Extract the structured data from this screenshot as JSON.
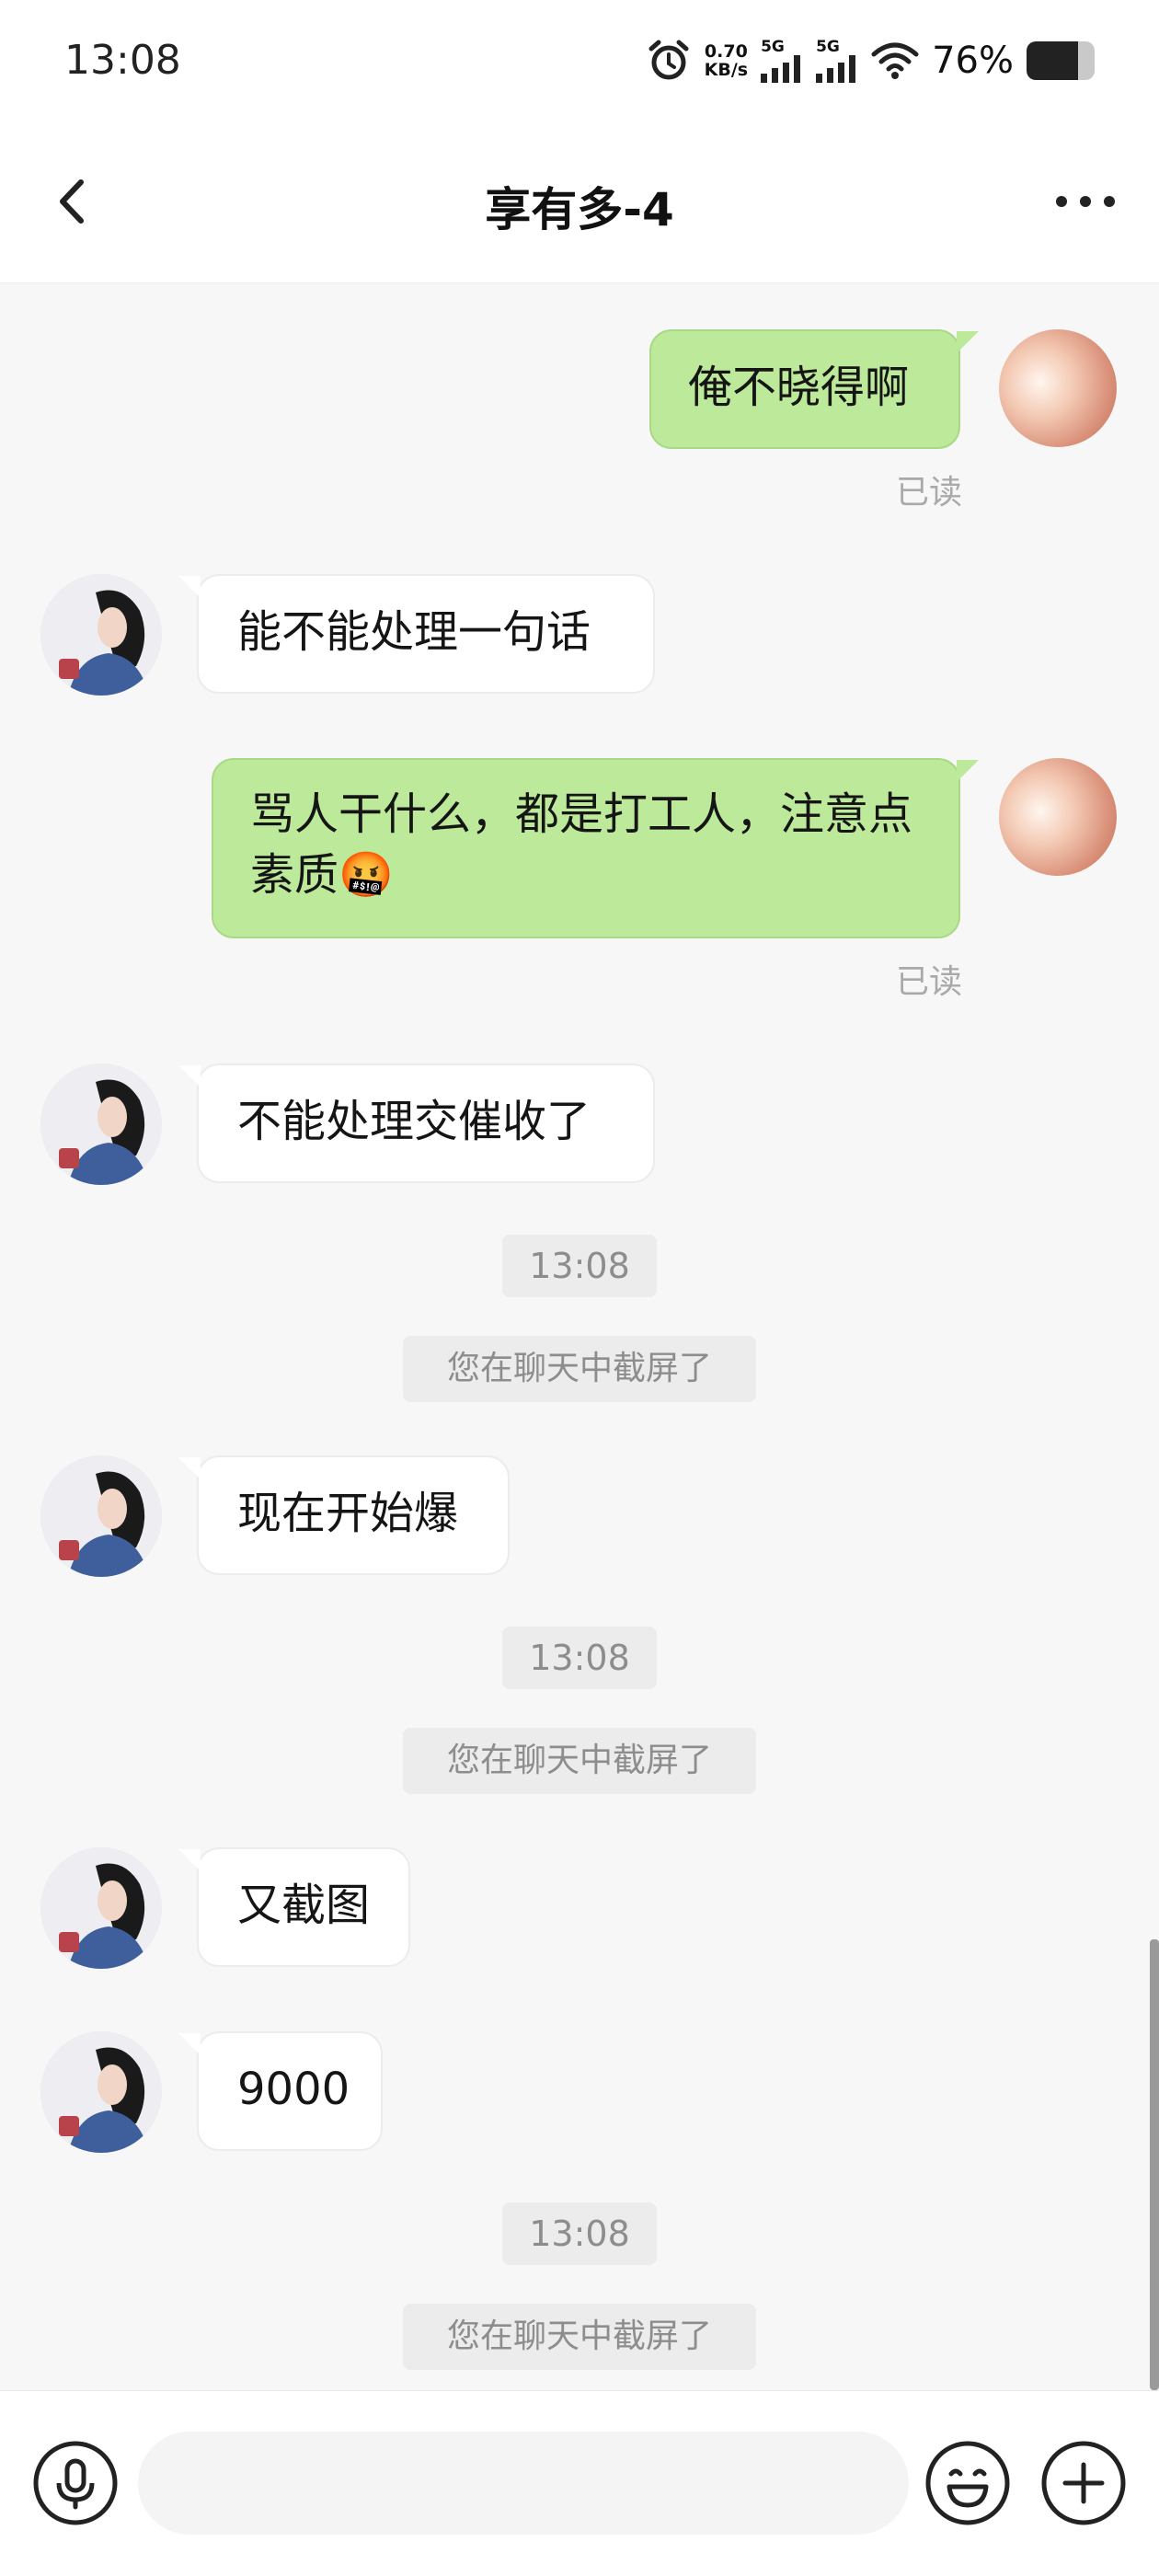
{
  "status_bar": {
    "time": "13:08",
    "net_speed_value": "0.70",
    "net_speed_unit": "KB/s",
    "sim1_label": "5G",
    "sim2_label": "5G",
    "battery_percent": "76%",
    "battery_level": 0.76,
    "icons": [
      "alarm-icon",
      "signal-icon",
      "signal-icon",
      "wifi-icon",
      "battery-icon"
    ]
  },
  "header": {
    "title": "享有多-4",
    "back_icon": "chevron-left-icon",
    "more_icon": "more-dots-icon"
  },
  "messages": [
    {
      "sender": "me",
      "text": "俺不晓得啊",
      "read": "已读"
    },
    {
      "sender": "other",
      "text": "能不能处理一句话"
    },
    {
      "sender": "me",
      "text": "骂人干什么，都是打工人，注意点素质🤬",
      "read": "已读"
    },
    {
      "sender": "other",
      "text": "不能处理交催收了"
    },
    {
      "type": "time",
      "text": "13:08"
    },
    {
      "type": "system",
      "text": "您在聊天中截屏了"
    },
    {
      "sender": "other",
      "text": "现在开始爆"
    },
    {
      "type": "time",
      "text": "13:08"
    },
    {
      "type": "system",
      "text": "您在聊天中截屏了"
    },
    {
      "sender": "other",
      "text": "又截图"
    },
    {
      "sender": "other",
      "text": "9000"
    },
    {
      "type": "time",
      "text": "13:08"
    },
    {
      "type": "system",
      "text": "您在聊天中截屏了"
    }
  ],
  "input_bar": {
    "placeholder": "",
    "icons": [
      "microphone-icon",
      "emoji-icon",
      "plus-icon"
    ]
  },
  "colors": {
    "my_bubble": "#bde99b",
    "other_bubble": "#ffffff",
    "background": "#f7f7f7"
  }
}
